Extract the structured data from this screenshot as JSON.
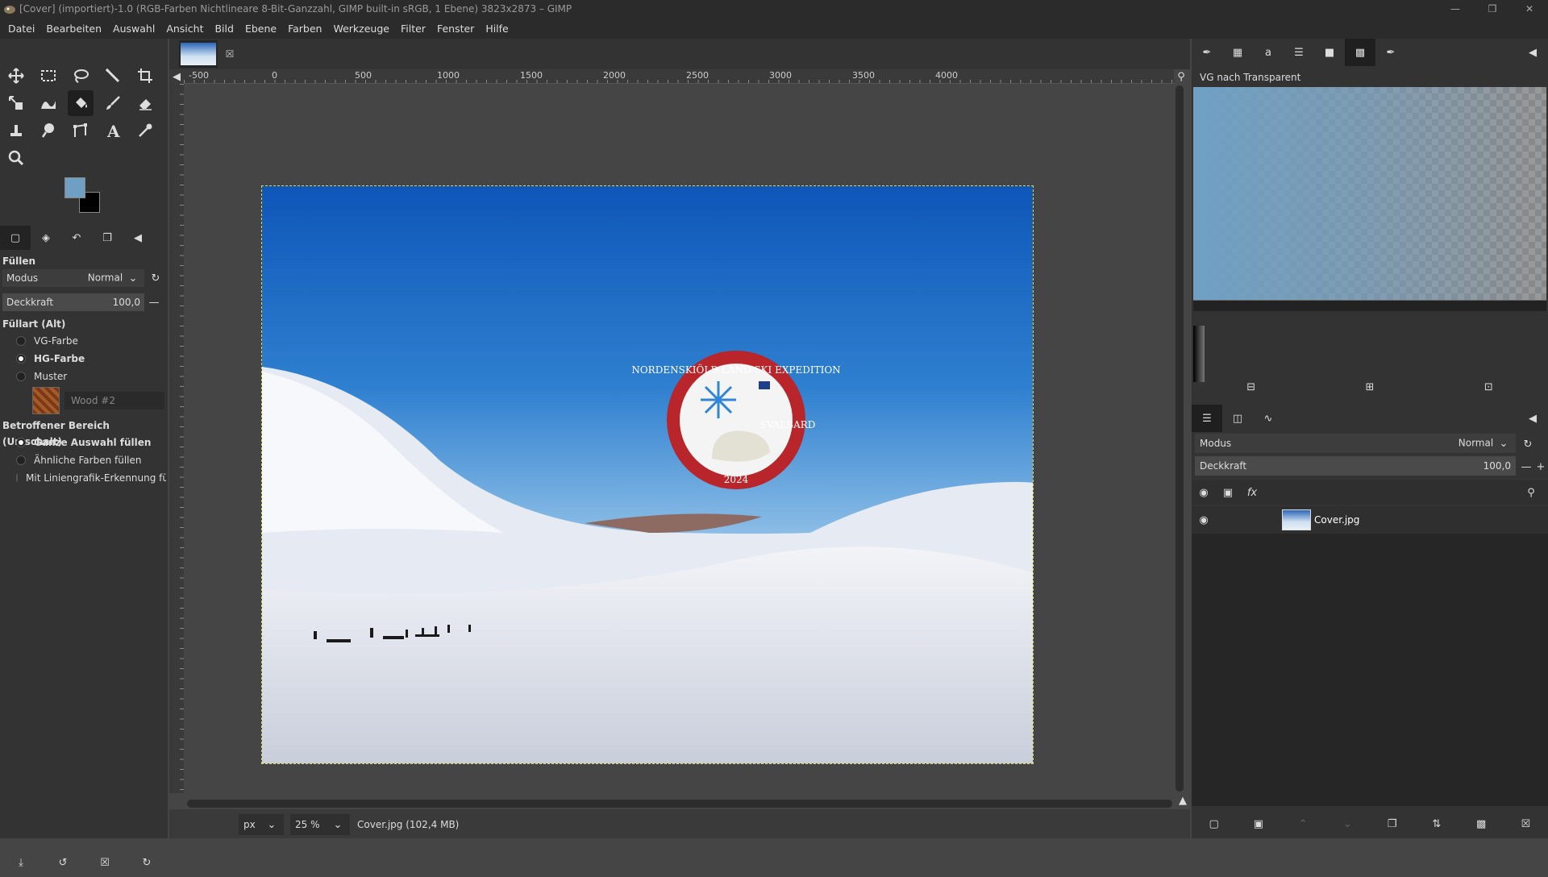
{
  "window": {
    "title": "[Cover] (importiert)-1.0 (RGB-Farben Nichtlineare 8-Bit-Ganzzahl, GIMP built-in sRGB, 1 Ebene) 3823x2873 – GIMP"
  },
  "menu": [
    "Datei",
    "Bearbeiten",
    "Auswahl",
    "Ansicht",
    "Bild",
    "Ebene",
    "Farben",
    "Werkzeuge",
    "Filter",
    "Fenster",
    "Hilfe"
  ],
  "colors": {
    "foreground": "#6fa0c4",
    "background": "#000000"
  },
  "tool_options": {
    "title": "Füllen",
    "mode_label": "Modus",
    "mode_value": "Normal",
    "opacity_label": "Deckkraft",
    "opacity_value": "100,0",
    "fill_type_title": "Füllart  (Alt)",
    "fill_types": [
      "VG-Farbe",
      "HG-Farbe",
      "Muster"
    ],
    "fill_type_selected": "HG-Farbe",
    "pattern_name": "Wood #2",
    "area_title": "Betroffener Bereich  (Umschalt)",
    "areas": [
      "Ganze Auswahl füllen",
      "Ähnliche Farben füllen",
      "Mit Liniengrafik-Erkennung füllen"
    ],
    "area_selected": "Ganze Auswahl füllen"
  },
  "ruler": {
    "h_labels": [
      "-500",
      "0",
      "500",
      "1000",
      "1500",
      "2000",
      "2500",
      "3000",
      "3500",
      "4000"
    ]
  },
  "status": {
    "unit": "px",
    "zoom": "25 %",
    "file_info": "Cover.jpg (102,4 MB)"
  },
  "image": {
    "badge_top": "NORDENSKIÖLD LAND SKI EXPEDITION",
    "badge_right": "SVALBARD",
    "badge_year": "2024"
  },
  "gradient": {
    "name": "VG nach Transparent"
  },
  "layers": {
    "mode_label": "Modus",
    "mode_value": "Normal",
    "opacity_label": "Deckkraft",
    "opacity_value": "100,0",
    "items": [
      {
        "name": "Cover.jpg"
      }
    ]
  }
}
